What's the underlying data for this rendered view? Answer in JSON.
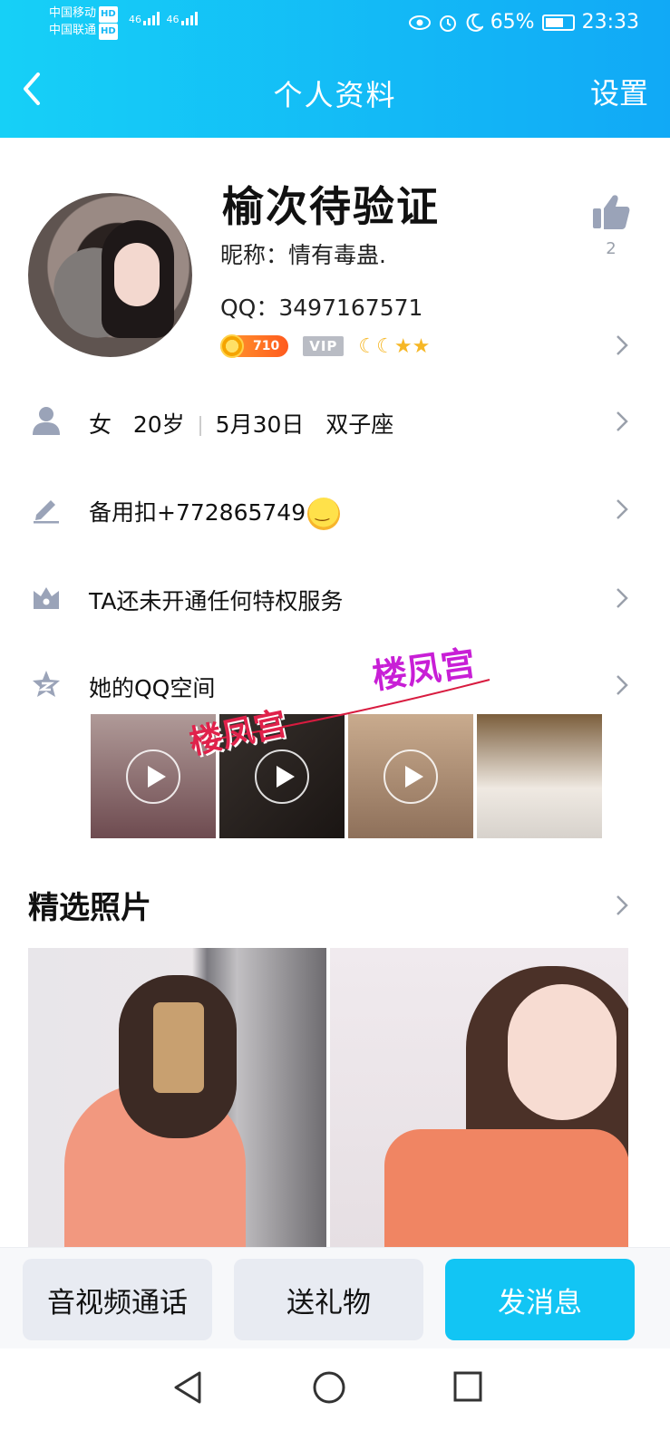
{
  "status_bar": {
    "carrier_1": "中国移动",
    "carrier_2": "中国联通",
    "hd_label": "HD",
    "network_1": "46",
    "network_2": "46",
    "battery": "65%",
    "time": "23:33"
  },
  "nav": {
    "title": "个人资料",
    "settings": "设置"
  },
  "profile": {
    "name": "榆次待验证",
    "nickname": "昵称：情有毒蛊.",
    "qq": "QQ：3497167571",
    "coin_level": "710",
    "vip_label": "VIP",
    "level_icons": "☾☾★★",
    "like_count": "2"
  },
  "info_rows": {
    "gender": "女",
    "age": "20岁",
    "birthday": "5月30日",
    "zodiac": "双子座",
    "signature": "备用扣+772865749",
    "privilege": "TA还未开通任何特权服务",
    "qzone": "她的QQ空间"
  },
  "watermarks": {
    "mark_1": "楼凤宫",
    "mark_2": "楼凤宫"
  },
  "photos_section": {
    "title": "精选照片"
  },
  "actions": {
    "call": "音视频通话",
    "gift": "送礼物",
    "message": "发消息"
  },
  "colors": {
    "header_start": "#16d0f7",
    "header_end": "#11a9f6",
    "primary_button": "#12c5f4",
    "secondary_button": "#e8ebf2"
  }
}
